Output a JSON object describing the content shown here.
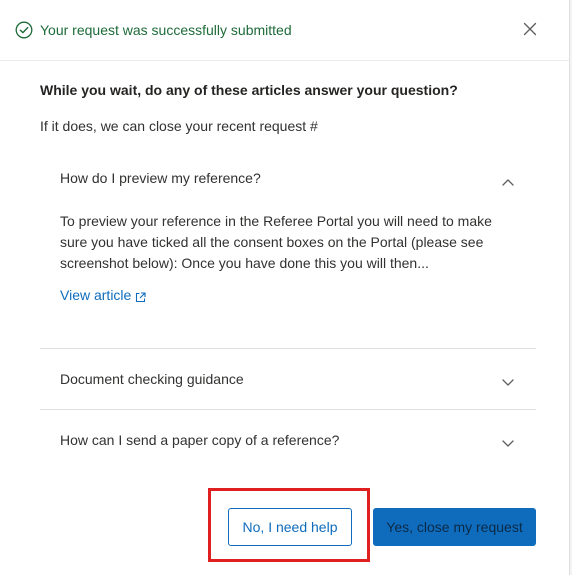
{
  "header": {
    "title": "Your request was successfully submitted",
    "icon": "check-circle-icon",
    "close_icon": "close-icon",
    "accent_color": "#1e6b3a"
  },
  "main": {
    "heading": "While you wait, do any of these articles answer your question?",
    "subtext": "If it does, we can close your recent request #",
    "articles": [
      {
        "title": "How do I preview my reference?",
        "expanded": true,
        "excerpt": "To preview your reference in the Referee Portal you will need to make sure you have ticked all the consent boxes on the Portal (please see screenshot below): Once you have done this you will then...",
        "link_label": "View article"
      },
      {
        "title": "Document checking guidance",
        "expanded": false
      },
      {
        "title": "How can I send a paper copy of a reference?",
        "expanded": false
      }
    ]
  },
  "footer": {
    "secondary_button": "No, I need help",
    "primary_button": "Yes, close my request",
    "primary_color": "#0f6cbd"
  }
}
